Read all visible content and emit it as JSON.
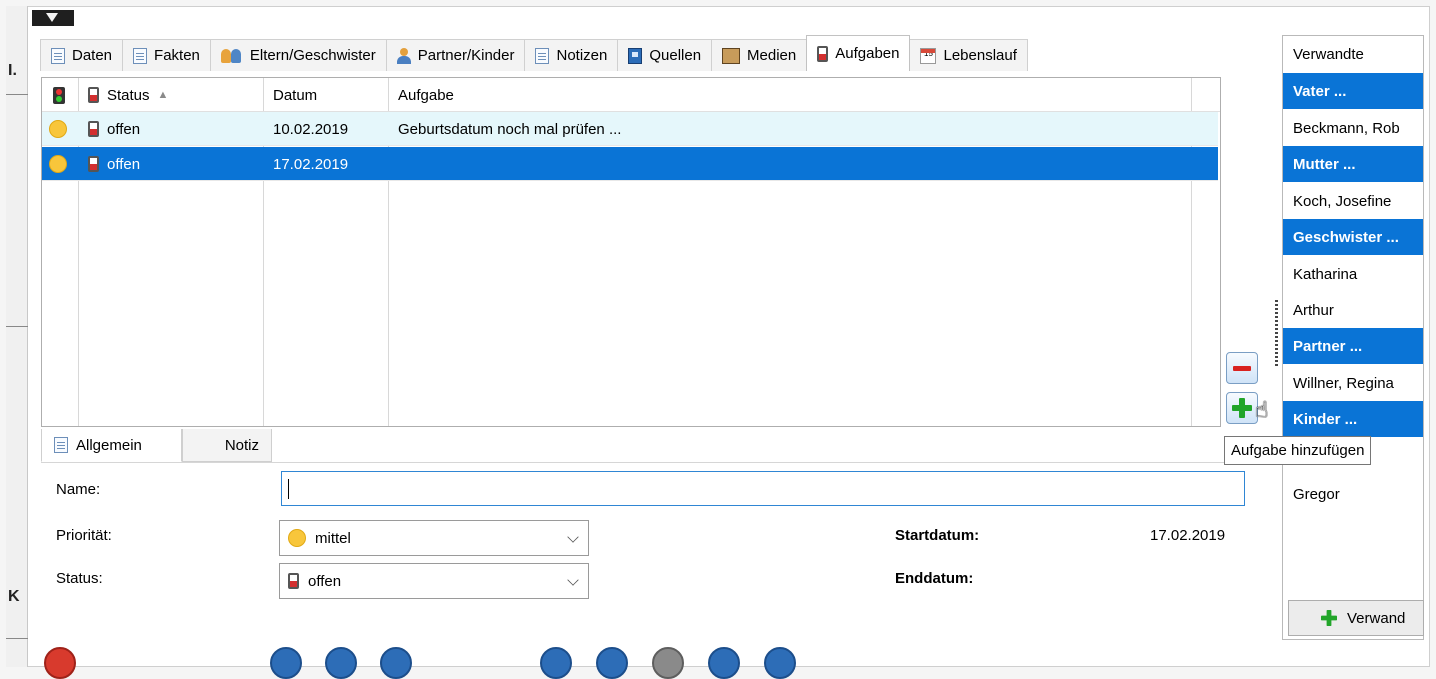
{
  "tabs": [
    {
      "label": "Daten",
      "icon": "document-icon"
    },
    {
      "label": "Fakten",
      "icon": "document-icon"
    },
    {
      "label": "Eltern/Geschwister",
      "icon": "people-icon"
    },
    {
      "label": "Partner/Kinder",
      "icon": "person-icon"
    },
    {
      "label": "Notizen",
      "icon": "document-icon"
    },
    {
      "label": "Quellen",
      "icon": "book-icon"
    },
    {
      "label": "Medien",
      "icon": "photo-icon"
    },
    {
      "label": "Aufgaben",
      "icon": "battery-icon",
      "active": true
    },
    {
      "label": "Lebenslauf",
      "icon": "calendar-icon"
    }
  ],
  "grid": {
    "headers": {
      "status": "Status",
      "datum": "Datum",
      "aufgabe": "Aufgabe"
    },
    "rows": [
      {
        "status": "offen",
        "datum": "10.02.2019",
        "aufgabe": "Geburtsdatum noch mal prüfen ..."
      },
      {
        "status": "offen",
        "datum": "17.02.2019",
        "aufgabe": ""
      }
    ]
  },
  "tooltip": "Aufgabe hinzufügen",
  "detail": {
    "tabs": {
      "allgemein": "Allgemein",
      "notiz": "Notiz"
    },
    "labels": {
      "name": "Name:",
      "prioritaet": "Priorität:",
      "status": "Status:",
      "startdatum": "Startdatum:",
      "enddatum": "Enddatum:"
    },
    "values": {
      "name": "",
      "prioritaet": "mittel",
      "status": "offen",
      "startdatum": "17.02.2019",
      "enddatum": ""
    },
    "calendar_icon_text": "15"
  },
  "relatives": {
    "title": "Verwandte",
    "items": [
      {
        "text": "Vater ...",
        "header": true
      },
      {
        "text": "Beckmann, Rob",
        "header": false
      },
      {
        "text": "Mutter ...",
        "header": true
      },
      {
        "text": "Koch, Josefine",
        "header": false
      },
      {
        "text": "Geschwister ...",
        "header": true
      },
      {
        "text": "Katharina",
        "header": false
      },
      {
        "text": "Arthur",
        "header": false
      },
      {
        "text": "Partner ...",
        "header": true
      },
      {
        "text": "Willner, Regina",
        "header": false
      },
      {
        "text": "Kinder ...",
        "header": true
      },
      {
        "text": "Gregor",
        "header": false
      }
    ],
    "add_button": "Verwand"
  },
  "colors": {
    "selection": "#0a74d6",
    "highlight_row": "#e5f7fb",
    "priority_medium": "#f8c63b",
    "add_green": "#22a52a",
    "remove_red": "#d9221f"
  }
}
